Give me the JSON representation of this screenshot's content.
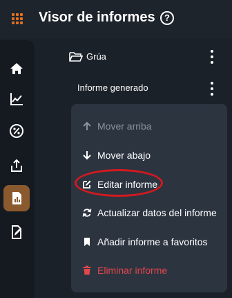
{
  "header": {
    "title": "Visor de informes",
    "help_glyph": "?"
  },
  "colors": {
    "accent": "#e2711d",
    "active_nav": "#8a5a2e",
    "danger": "#e2474b",
    "highlight_ring": "#d21a1f"
  },
  "sidebar": {
    "items": [
      {
        "icon": "home-icon"
      },
      {
        "icon": "line-chart-icon"
      },
      {
        "icon": "percent-icon"
      },
      {
        "icon": "share-upload-icon"
      },
      {
        "icon": "report-icon",
        "active": true
      },
      {
        "icon": "edit-document-icon"
      }
    ]
  },
  "tree": {
    "folder": {
      "label": "Grúa",
      "icon": "folder-open-icon"
    },
    "report": {
      "label": "Informe generado"
    }
  },
  "context_menu": {
    "items": [
      {
        "label": "Mover arriba",
        "icon": "arrow-up-icon",
        "state": "disabled"
      },
      {
        "label": "Mover abajo",
        "icon": "arrow-down-icon"
      },
      {
        "label": "Editar informe",
        "icon": "edit-icon",
        "highlighted": true
      },
      {
        "label": "Actualizar datos del informe",
        "icon": "refresh-icon"
      },
      {
        "label": "Añadir informe a favoritos",
        "icon": "bookmark-icon"
      },
      {
        "label": "Eliminar informe",
        "icon": "trash-icon",
        "state": "danger"
      }
    ]
  }
}
